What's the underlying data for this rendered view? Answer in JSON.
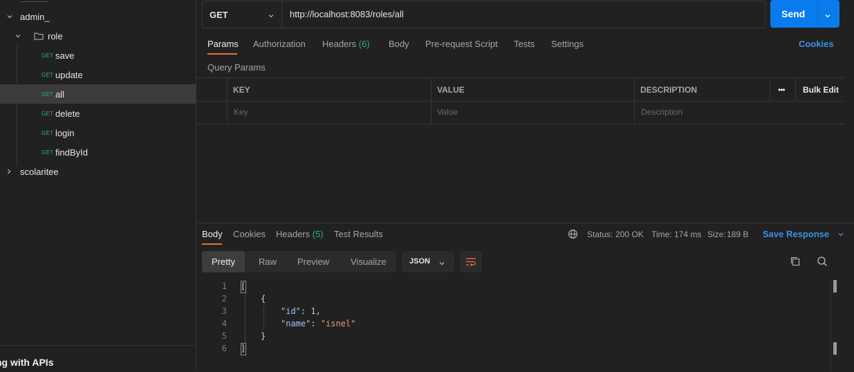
{
  "sidebar": {
    "collections": [
      {
        "name": "admin_"
      },
      {
        "name": "scolaritee"
      }
    ],
    "folder": {
      "name": "role"
    },
    "requests": [
      {
        "method": "GET",
        "name": "save"
      },
      {
        "method": "GET",
        "name": "update"
      },
      {
        "method": "GET",
        "name": "all"
      },
      {
        "method": "GET",
        "name": "delete"
      },
      {
        "method": "GET",
        "name": "login"
      },
      {
        "method": "GET",
        "name": "findById"
      }
    ],
    "footer": "ng with APIs"
  },
  "request": {
    "method": "GET",
    "url": "http://localhost:8083/roles/all",
    "send_label": "Send"
  },
  "request_tabs": {
    "params": "Params",
    "authorization": "Authorization",
    "headers": "Headers",
    "headers_count": "(6)",
    "body": "Body",
    "pre_request": "Pre-request Script",
    "tests": "Tests",
    "settings": "Settings",
    "cookies": "Cookies"
  },
  "query_params": {
    "title": "Query Params",
    "headers": {
      "key": "KEY",
      "value": "VALUE",
      "description": "DESCRIPTION",
      "more": "•••",
      "bulk_edit": "Bulk Edit"
    },
    "placeholders": {
      "key": "Key",
      "value": "Value",
      "description": "Description"
    }
  },
  "response": {
    "tabs": {
      "body": "Body",
      "cookies": "Cookies",
      "headers": "Headers",
      "headers_count": "(5)",
      "test_results": "Test Results"
    },
    "status_label": "Status:",
    "status_value": "200 OK",
    "time_label": "Time:",
    "time_value": "174 ms",
    "size_label": "Size:",
    "size_value": "189 B",
    "save_response": "Save Response",
    "views": [
      "Pretty",
      "Raw",
      "Preview",
      "Visualize"
    ],
    "format": "JSON",
    "lines": [
      "1",
      "2",
      "3",
      "4",
      "5",
      "6"
    ],
    "json": {
      "open_array": "[",
      "open_obj": "{",
      "k1": "\"id\"",
      "v1": "1",
      "k2": "\"name\"",
      "v2": "\"isnel\"",
      "close_obj": "}",
      "close_array": "]"
    }
  }
}
